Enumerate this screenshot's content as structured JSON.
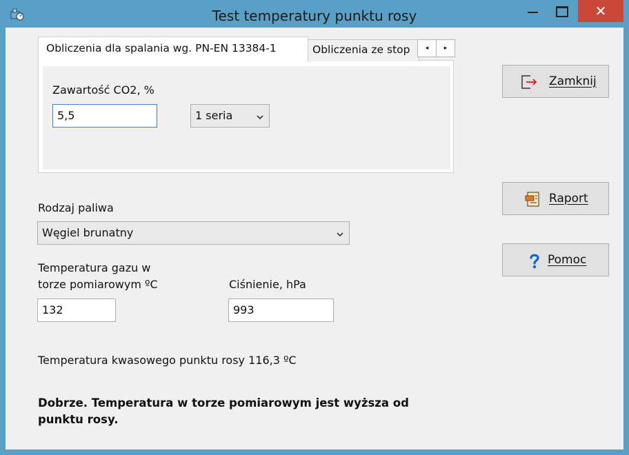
{
  "window": {
    "title": "Test temperatury punktu rosy",
    "close_glyph": "✕"
  },
  "tabs": [
    {
      "label": "Obliczenia dla spalania wg. PN-EN 13384-1",
      "active": true
    },
    {
      "label": "Obliczenia ze stop",
      "active": false
    }
  ],
  "tab_scroll": {
    "left": "◂",
    "right": "▸"
  },
  "co2": {
    "label": "Zawartość CO2, %",
    "value": "5,5",
    "series_selected": "1 seria"
  },
  "fuel": {
    "label": "Rodzaj paliwa",
    "selected": "Węgiel brunatny"
  },
  "gas_temp": {
    "label_line1": "Temperatura gazu w",
    "label_line2": "torze pomiarowym ºC",
    "value": "132"
  },
  "pressure": {
    "label": "Ciśnienie, hPa",
    "value": "993"
  },
  "result": {
    "dew_point_text": "Temperatura kwasowego punktu rosy 116,3 ºC",
    "message": "Dobrze. Temperatura w torze pomiarowym jest wyższa od punktu rosy."
  },
  "buttons": {
    "close": "Zamknij",
    "report": "Raport",
    "help": "Pomoc"
  },
  "icons": {
    "app": "gauge-app-icon",
    "exit": "exit-door-icon",
    "report": "report-icon",
    "help": "question-mark-icon"
  },
  "colors": {
    "titlebar": "#5a9fc6",
    "close_button": "#c9483a",
    "focus_border": "#3c7fd0",
    "help_icon": "#1565c0",
    "exit_arrow": "#d21f1f"
  }
}
